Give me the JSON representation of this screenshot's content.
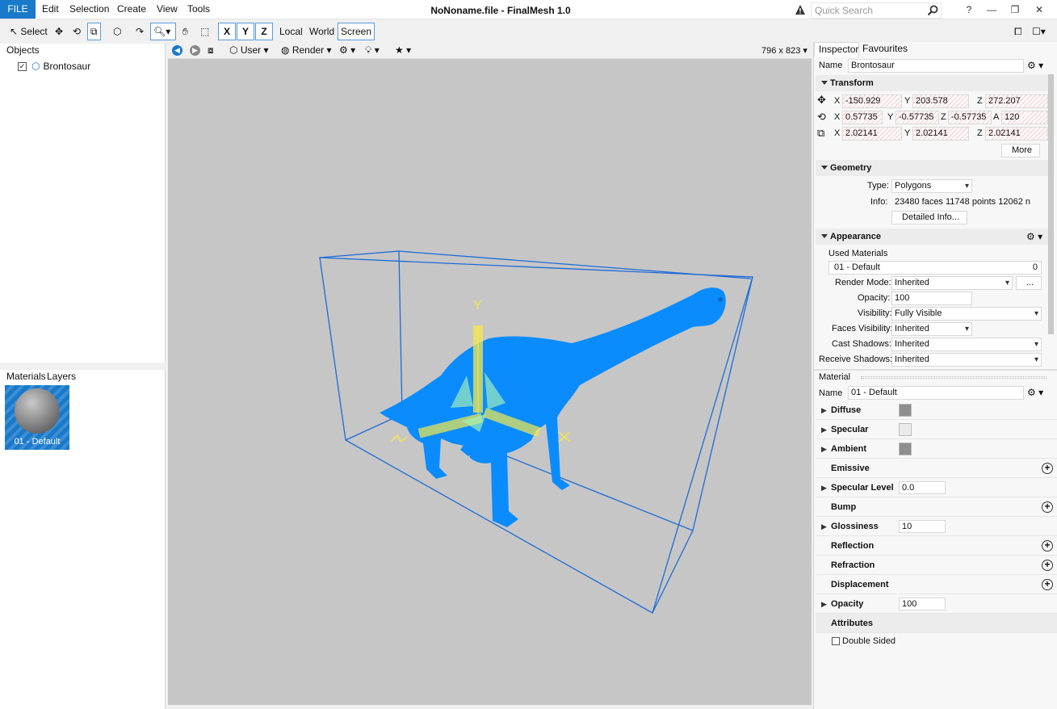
{
  "app": {
    "title": "NoNoname.file - FinalMesh 1.0",
    "file_label": "FILE",
    "menus": [
      "Edit",
      "Selection",
      "Create",
      "View",
      "Tools"
    ],
    "search_placeholder": "Quick Search",
    "colors": {
      "accent": "#1979ca",
      "mesh": "#0a8cff",
      "bbox": "#1e6bd6",
      "gizmo": "#f2e84a",
      "viewport_bg": "#c6c6c6"
    }
  },
  "toolbar": {
    "select_label": "Select",
    "axis_x": "X",
    "axis_y": "Y",
    "axis_z": "Z",
    "space_local": "Local",
    "space_world": "World",
    "space_screen": "Screen"
  },
  "objects": {
    "tab": "Objects",
    "items": [
      {
        "label": "Brontosaur",
        "checked": true
      }
    ]
  },
  "materials_panel": {
    "tabs": [
      "Materials",
      "Layers"
    ],
    "items": [
      {
        "label": "01 - Default"
      }
    ]
  },
  "viewport": {
    "camera_label": "User",
    "render_label": "Render",
    "size_label": "796 x 823",
    "gizmo_y_label": "Y"
  },
  "inspector": {
    "tabs": [
      "Inspector",
      "Favourites"
    ],
    "name_label": "Name",
    "name_value": "Brontosaur",
    "transform": {
      "title": "Transform",
      "position": {
        "x": "-150.929",
        "y": "203.578",
        "z": "272.207"
      },
      "rotation": {
        "x": "0.57735",
        "y": "-0.57735",
        "z": "-0.57735",
        "a": "120"
      },
      "scale": {
        "x": "2.02141",
        "y": "2.02141",
        "z": "2.02141"
      },
      "axis_x": "X",
      "axis_y": "Y",
      "axis_z": "Z",
      "axis_a": "A",
      "more_label": "More"
    },
    "geometry": {
      "title": "Geometry",
      "type_label": "Type:",
      "type_value": "Polygons",
      "info_label": "Info:",
      "info_value": "23480 faces 11748 points 12062 n",
      "detailed_label": "Detailed Info..."
    },
    "appearance": {
      "title": "Appearance",
      "used_materials_label": "Used Materials",
      "material_name": "01 - Default",
      "material_count": "0",
      "render_mode_label": "Render Mode:",
      "render_mode_value": "Inherited",
      "ellipsis": "...",
      "opacity_label": "Opacity:",
      "opacity_value": "100",
      "visibility_label": "Visibility:",
      "visibility_value": "Fully Visible",
      "faces_label": "Faces Visibility:",
      "faces_value": "Inherited",
      "cast_label": "Cast Shadows:",
      "cast_value": "Inherited",
      "receive_label": "Receive Shadows:",
      "receive_value": "Inherited"
    },
    "material": {
      "section_label": "Material",
      "name_label": "Name",
      "name_value": "01 - Default",
      "rows": [
        {
          "label": "Diffuse",
          "kind": "swatch",
          "color": "#8e8e8e"
        },
        {
          "label": "Specular",
          "kind": "swatch",
          "color": "#ebebeb"
        },
        {
          "label": "Ambient",
          "kind": "swatch",
          "color": "#8e8e8e"
        },
        {
          "label": "Emissive",
          "kind": "plus"
        },
        {
          "label": "Specular Level",
          "kind": "spin",
          "value": "0.0"
        },
        {
          "label": "Bump",
          "kind": "plus"
        },
        {
          "label": "Glossiness",
          "kind": "spin",
          "value": "10"
        },
        {
          "label": "Reflection",
          "kind": "plus"
        },
        {
          "label": "Refraction",
          "kind": "plus"
        },
        {
          "label": "Displacement",
          "kind": "plus"
        },
        {
          "label": "Opacity",
          "kind": "spin",
          "value": "100"
        }
      ],
      "attributes_label": "Attributes",
      "double_sided_label": "Double Sided"
    }
  }
}
